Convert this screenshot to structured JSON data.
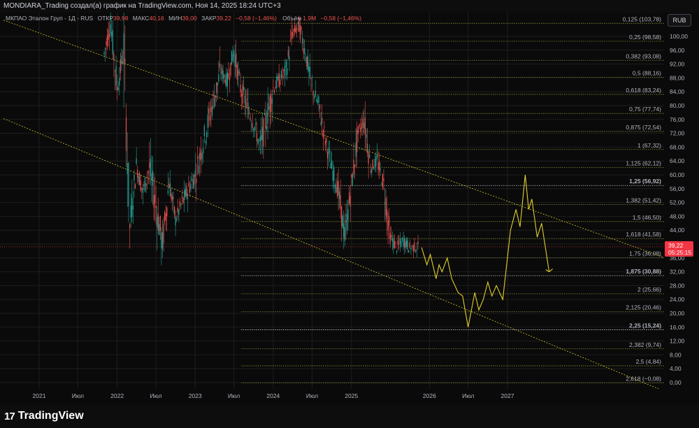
{
  "header": {
    "attribution": "MONDIARA_Trading создал(а) график на TradingView.com, Ноя 14, 2025 18:24 UTC+3"
  },
  "legend": {
    "symbol": "МКПАО Эталон Груп - 1Д - RUS",
    "o_label": "ОТКР",
    "o_value": "39,98",
    "h_label": "МАКС",
    "h_value": "40,16",
    "l_label": "МИН",
    "l_value": "39,00",
    "c_label": "ЗАКР",
    "c_value": "39,22",
    "change": "−0,58 (−1,46%)",
    "vol_label": "Объём",
    "vol_value": "1,9M",
    "vol_change": "−0,58 (−1,46%)"
  },
  "currency_button": "RUB",
  "price_badge": {
    "price": "39,22",
    "countdown": "05:25:15"
  },
  "footer": {
    "brand": "TradingView",
    "brand_mark": "17"
  },
  "colors": {
    "up": "#26a69a",
    "down": "#ef5350",
    "fib": "#d4c22a",
    "projection": "#e2cf2e",
    "grid": "#1e1e1e",
    "current_price": "#f23645"
  },
  "chart_data": {
    "type": "candlestick",
    "title": "",
    "yaxis_ticks": [
      "100,00",
      "96,00",
      "92,00",
      "88,00",
      "84,00",
      "80,00",
      "76,00",
      "72,00",
      "68,00",
      "64,00",
      "60,00",
      "56,00",
      "52,00",
      "48,00",
      "44,00",
      "40,00",
      "36,00",
      "32,00",
      "28,00",
      "24,00",
      "20,00",
      "16,00",
      "12,00",
      "8,00",
      "4,00",
      "0,00"
    ],
    "yaxis_values": [
      100,
      96,
      92,
      88,
      84,
      80,
      76,
      72,
      68,
      64,
      60,
      56,
      52,
      48,
      44,
      40,
      36,
      32,
      28,
      24,
      20,
      16,
      12,
      8,
      4,
      0
    ],
    "ylim": [
      -2,
      104
    ],
    "xaxis_ticks": [
      {
        "label": "2021",
        "date": "2021-01-01"
      },
      {
        "label": "Июл",
        "date": "2021-07-01"
      },
      {
        "label": "2022",
        "date": "2022-01-01"
      },
      {
        "label": "Июл",
        "date": "2022-07-01"
      },
      {
        "label": "2023",
        "date": "2023-01-01"
      },
      {
        "label": "Июл",
        "date": "2023-07-01"
      },
      {
        "label": "2024",
        "date": "2024-01-01"
      },
      {
        "label": "Июл",
        "date": "2024-07-01"
      },
      {
        "label": "2025",
        "date": "2025-01-01"
      },
      {
        "label": "2026",
        "date": "2026-01-01"
      },
      {
        "label": "Июл",
        "date": "2026-07-01"
      },
      {
        "label": "2027",
        "date": "2027-01-01"
      }
    ],
    "price_path": [
      {
        "date": "2021-11-01",
        "close": 95
      },
      {
        "date": "2021-12-01",
        "close": 104
      },
      {
        "date": "2022-01-01",
        "close": 85
      },
      {
        "date": "2022-02-01",
        "close": 96
      },
      {
        "date": "2022-03-01",
        "close": 45
      },
      {
        "date": "2022-04-01",
        "close": 63
      },
      {
        "date": "2022-05-01",
        "close": 55
      },
      {
        "date": "2022-06-01",
        "close": 62
      },
      {
        "date": "2022-08-01",
        "close": 40
      },
      {
        "date": "2022-09-01",
        "close": 58
      },
      {
        "date": "2022-10-01",
        "close": 47
      },
      {
        "date": "2022-11-01",
        "close": 52
      },
      {
        "date": "2023-01-01",
        "close": 60
      },
      {
        "date": "2023-03-01",
        "close": 75
      },
      {
        "date": "2023-05-01",
        "close": 90
      },
      {
        "date": "2023-06-01",
        "close": 87
      },
      {
        "date": "2023-07-01",
        "close": 96
      },
      {
        "date": "2023-08-01",
        "close": 85
      },
      {
        "date": "2023-10-01",
        "close": 75
      },
      {
        "date": "2023-11-01",
        "close": 68
      },
      {
        "date": "2024-01-01",
        "close": 85
      },
      {
        "date": "2024-03-01",
        "close": 90
      },
      {
        "date": "2024-04-01",
        "close": 101
      },
      {
        "date": "2024-05-01",
        "close": 103
      },
      {
        "date": "2024-06-01",
        "close": 95
      },
      {
        "date": "2024-07-01",
        "close": 85
      },
      {
        "date": "2024-08-01",
        "close": 80
      },
      {
        "date": "2024-09-01",
        "close": 70
      },
      {
        "date": "2024-10-01",
        "close": 62
      },
      {
        "date": "2024-11-01",
        "close": 55
      },
      {
        "date": "2024-12-01",
        "close": 42
      },
      {
        "date": "2025-01-01",
        "close": 57
      },
      {
        "date": "2025-02-01",
        "close": 72
      },
      {
        "date": "2025-03-01",
        "close": 76
      },
      {
        "date": "2025-04-01",
        "close": 62
      },
      {
        "date": "2025-05-01",
        "close": 64
      },
      {
        "date": "2025-06-01",
        "close": 57
      },
      {
        "date": "2025-07-01",
        "close": 42
      },
      {
        "date": "2025-08-01",
        "close": 39
      },
      {
        "date": "2025-09-01",
        "close": 41
      },
      {
        "date": "2025-10-01",
        "close": 39
      },
      {
        "date": "2025-11-14",
        "close": 39.22
      }
    ],
    "current_price": 39.22,
    "fib_levels": [
      {
        "label": "0,125 (103,78)",
        "value": 103.78,
        "highlight": false
      },
      {
        "label": "0,25 (98,58)",
        "value": 98.58,
        "highlight": false
      },
      {
        "label": "0,382 (93,08)",
        "value": 93.08,
        "highlight": false
      },
      {
        "label": "0,5 (88,16)",
        "value": 88.16,
        "highlight": false
      },
      {
        "label": "0,618 (83,24)",
        "value": 83.24,
        "highlight": false
      },
      {
        "label": "0,75 (77,74)",
        "value": 77.74,
        "highlight": false
      },
      {
        "label": "0,875 (72,54)",
        "value": 72.54,
        "highlight": false
      },
      {
        "label": "1 (67,32)",
        "value": 67.32,
        "highlight": false
      },
      {
        "label": "1,125 (62,12)",
        "value": 62.12,
        "highlight": false
      },
      {
        "label": "1,25 (56,92)",
        "value": 56.92,
        "highlight": true
      },
      {
        "label": "1,382 (51,42)",
        "value": 51.42,
        "highlight": false
      },
      {
        "label": "1,5 (46,50)",
        "value": 46.5,
        "highlight": false
      },
      {
        "label": "1,618 (41,58)",
        "value": 41.58,
        "highlight": false
      },
      {
        "label": "1,75 (36,08)",
        "value": 36.08,
        "highlight": false
      },
      {
        "label": "1,875 (30,88)",
        "value": 30.88,
        "highlight": true
      },
      {
        "label": "2 (25,66)",
        "value": 25.66,
        "highlight": false
      },
      {
        "label": "2,125 (20,46)",
        "value": 20.46,
        "highlight": false
      },
      {
        "label": "2,25 (15,24)",
        "value": 15.24,
        "highlight": true
      },
      {
        "label": "2,382 (9,74)",
        "value": 9.74,
        "highlight": false
      },
      {
        "label": "2,5 (4,84)",
        "value": 4.84,
        "highlight": false
      },
      {
        "label": "2,618 (−0,08)",
        "value": -0.08,
        "highlight": false
      }
    ],
    "channel_upper": [
      {
        "date": "2021-01-01",
        "value": 101
      },
      {
        "date": "2027-09-01",
        "value": 47
      }
    ],
    "channel_lower": [
      {
        "date": "2021-01-01",
        "value": 72
      },
      {
        "date": "2027-09-01",
        "value": 10
      }
    ],
    "projection": [
      {
        "date": "2025-11-25",
        "value": 39
      },
      {
        "date": "2025-12-20",
        "value": 34
      },
      {
        "date": "2026-01-05",
        "value": 37
      },
      {
        "date": "2026-02-01",
        "value": 30
      },
      {
        "date": "2026-02-15",
        "value": 34
      },
      {
        "date": "2026-03-01",
        "value": 32
      },
      {
        "date": "2026-03-25",
        "value": 36
      },
      {
        "date": "2026-04-15",
        "value": 30
      },
      {
        "date": "2026-05-15",
        "value": 26
      },
      {
        "date": "2026-06-05",
        "value": 25
      },
      {
        "date": "2026-07-01",
        "value": 16
      },
      {
        "date": "2026-08-01",
        "value": 26
      },
      {
        "date": "2026-08-20",
        "value": 21
      },
      {
        "date": "2026-09-10",
        "value": 24
      },
      {
        "date": "2026-10-01",
        "value": 29
      },
      {
        "date": "2026-10-20",
        "value": 25
      },
      {
        "date": "2026-11-10",
        "value": 28
      },
      {
        "date": "2026-12-10",
        "value": 24
      },
      {
        "date": "2027-01-15",
        "value": 44
      },
      {
        "date": "2027-02-10",
        "value": 50
      },
      {
        "date": "2027-03-01",
        "value": 45
      },
      {
        "date": "2027-03-25",
        "value": 60
      },
      {
        "date": "2027-04-10",
        "value": 50
      },
      {
        "date": "2027-04-25",
        "value": 53
      },
      {
        "date": "2027-05-20",
        "value": 42
      },
      {
        "date": "2027-06-10",
        "value": 46
      },
      {
        "date": "2027-07-15",
        "value": 32
      }
    ]
  }
}
